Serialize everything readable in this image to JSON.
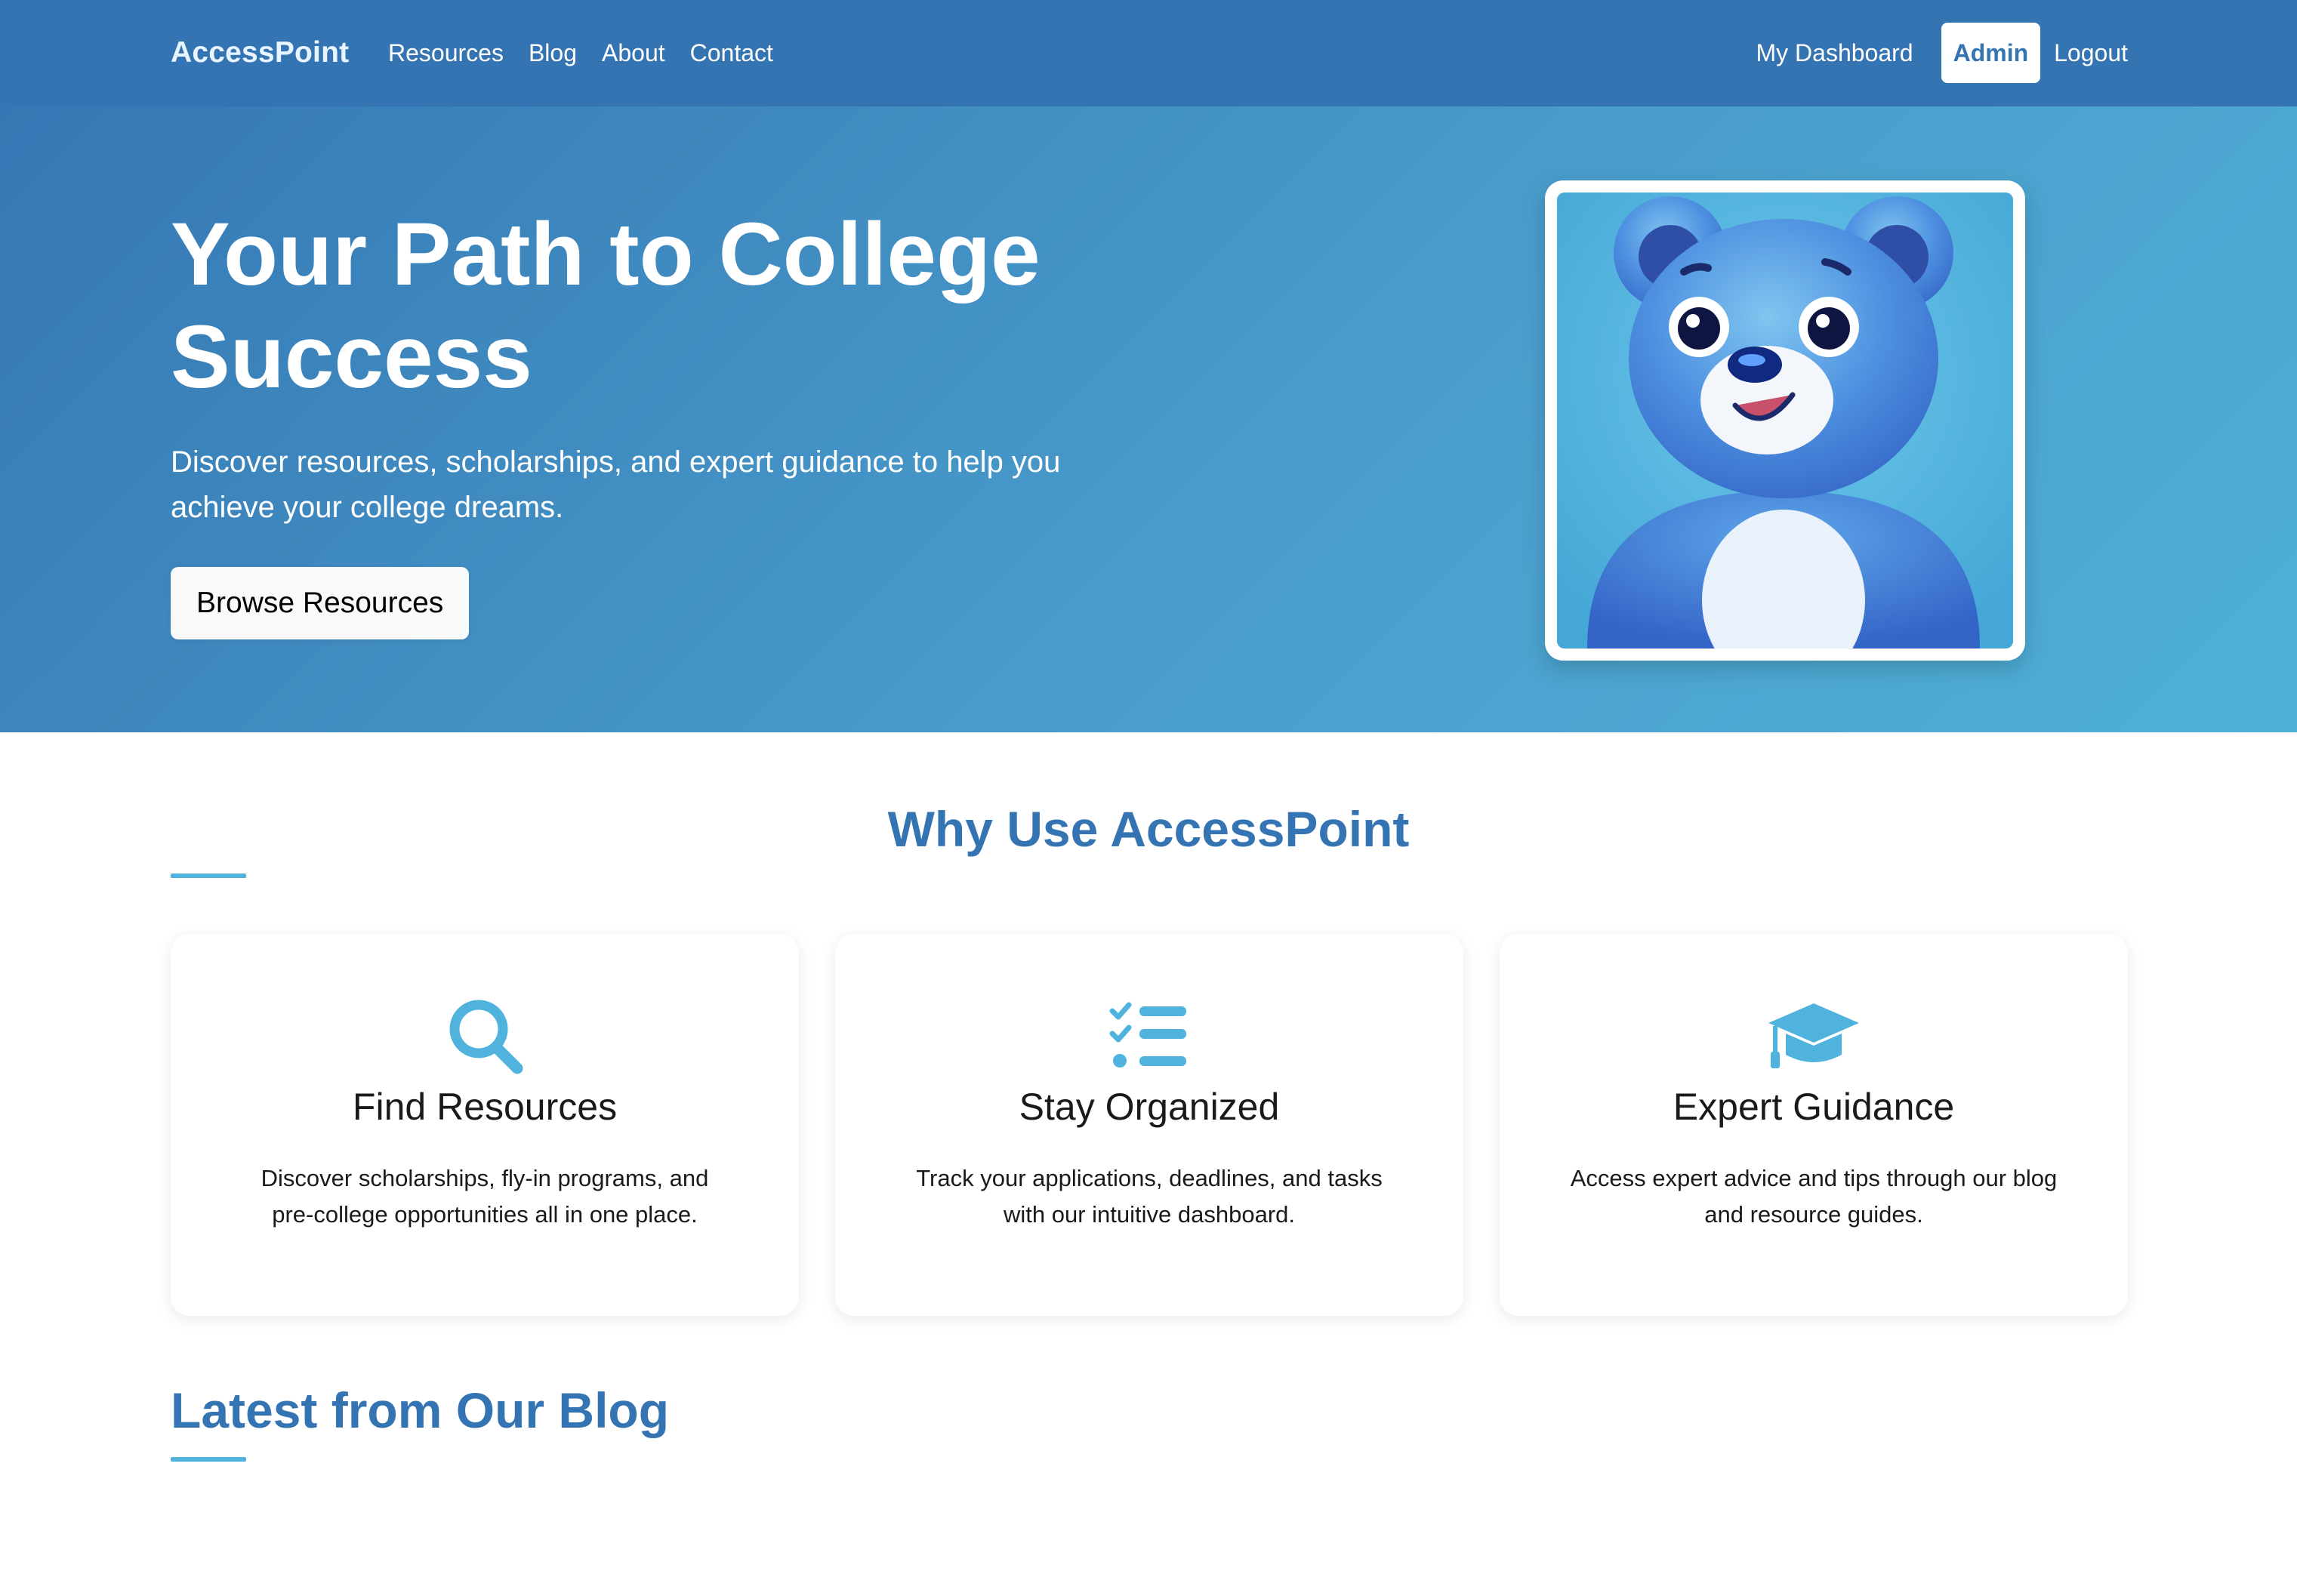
{
  "nav": {
    "brand": "AccessPoint",
    "links": [
      "Resources",
      "Blog",
      "About",
      "Contact"
    ],
    "dashboard": "My Dashboard",
    "admin": "Admin",
    "logout": "Logout"
  },
  "hero": {
    "title": "Your Path to College Success",
    "subtitle": "Discover resources, scholarships, and expert guidance to help you achieve your college dreams.",
    "button": "Browse Resources",
    "image_icon": "blue-bear-mascot"
  },
  "why": {
    "title": "Why Use AccessPoint",
    "cards": [
      {
        "icon": "search-icon",
        "title": "Find Resources",
        "text": "Discover scholarships, fly-in programs, and pre-college opportunities all in one place."
      },
      {
        "icon": "checklist-icon",
        "title": "Stay Organized",
        "text": "Track your applications, deadlines, and tasks with our intuitive dashboard."
      },
      {
        "icon": "graduation-cap-icon",
        "title": "Expert Guidance",
        "text": "Access expert advice and tips through our blog and resource guides."
      }
    ]
  },
  "blog": {
    "title": "Latest from Our Blog"
  },
  "colors": {
    "primary": "#3474b2",
    "accent": "#4fb3dd"
  }
}
